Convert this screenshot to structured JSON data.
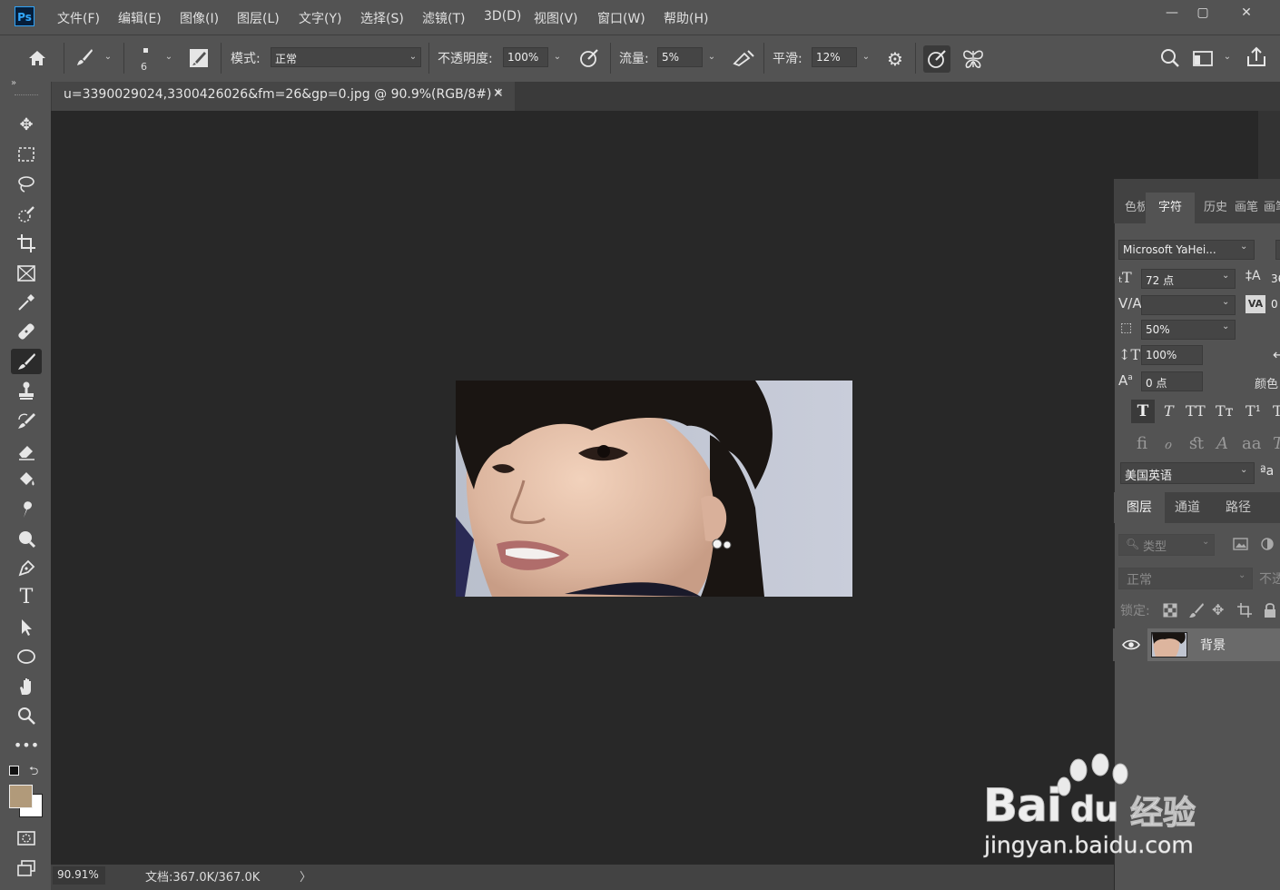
{
  "app": {
    "logo": "Ps"
  },
  "menu": [
    "文件(F)",
    "编辑(E)",
    "图像(I)",
    "图层(L)",
    "文字(Y)",
    "选择(S)",
    "滤镜(T)",
    "3D(D)",
    "视图(V)",
    "窗口(W)",
    "帮助(H)"
  ],
  "window_controls": {
    "minimize": "—",
    "maximize": "▢",
    "close": "✕"
  },
  "options": {
    "brush_size": "6",
    "mode_label": "模式:",
    "mode_value": "正常",
    "opacity_label": "不透明度:",
    "opacity_value": "100%",
    "flow_label": "流量:",
    "flow_value": "5%",
    "smooth_label": "平滑:",
    "smooth_value": "12%"
  },
  "document": {
    "tab_title": "u=3390029024,3300426026&fm=26&gp=0.jpg @ 90.9%(RGB/8#) *",
    "close": "✕"
  },
  "status": {
    "zoom": "90.91%",
    "doc_size": "文档:367.0K/367.0K",
    "arrow": "〉"
  },
  "character_panel": {
    "tabs": [
      "色板",
      "字符",
      "历史",
      "画笔",
      "画笔"
    ],
    "active_tab": "字符",
    "font_family": "Microsoft YaHei...",
    "font_size": "72 点",
    "leading_partial": "36",
    "kerning": "",
    "tracking_partial": "0",
    "tsume": "50%",
    "vertical_scale": "100%",
    "baseline_shift": "0 点",
    "color_label_partial": "颜色",
    "language": "美国英语",
    "aa_label": "ªa"
  },
  "layers_panel": {
    "tabs": [
      "图层",
      "通道",
      "路径"
    ],
    "active_tab": "图层",
    "filter_placeholder": "类型",
    "blend_mode": "正常",
    "opacity_partial": "不透",
    "lock_label": "锁定:",
    "layers": [
      {
        "name": "背景",
        "visible": true
      }
    ]
  },
  "watermark": {
    "brand": "Bai",
    "du": "du",
    "jingyan": "经验",
    "url": "jingyan.baidu.com"
  },
  "colors": {
    "foreground": "#b19a7a",
    "background": "#ffffff",
    "ui_dark": "#282828",
    "ui_panel": "#535353",
    "ps_blue": "#31a8ff"
  }
}
